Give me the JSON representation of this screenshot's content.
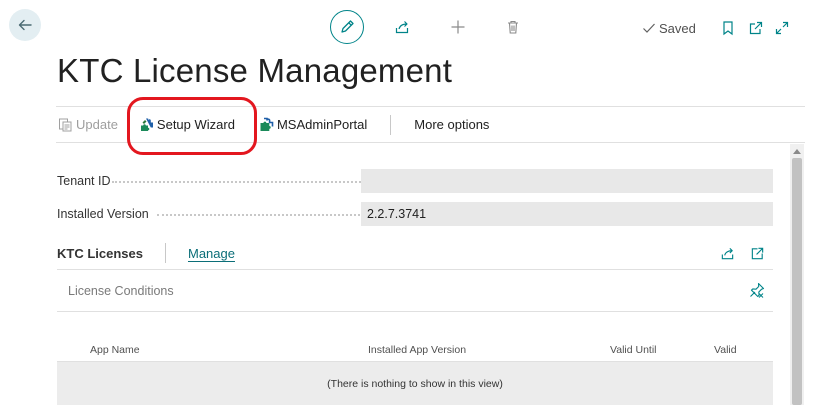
{
  "page": {
    "title": "KTC License Management",
    "status": "Saved"
  },
  "actions": {
    "update": "Update",
    "setup_wizard": "Setup Wizard",
    "ms_admin_portal": "MSAdminPortal",
    "more_options": "More options"
  },
  "fields": {
    "tenant_id": {
      "label": "Tenant ID",
      "value": ""
    },
    "installed_version": {
      "label": "Installed Version",
      "value": "2.2.7.3741"
    }
  },
  "subpage": {
    "title": "KTC Licenses",
    "manage": "Manage",
    "part_title": "License Conditions",
    "columns": [
      "App Name",
      "Installed App Version",
      "Valid Until",
      "Valid"
    ],
    "empty_text": "(There is nothing to show in this view)"
  },
  "colors": {
    "accent": "#008489",
    "highlight": "#e3171f"
  },
  "icons": [
    "back-arrow-icon",
    "pencil-icon",
    "share-icon",
    "plus-icon",
    "trash-icon",
    "check-icon",
    "bookmark-icon",
    "open-new-window-icon",
    "expand-icon",
    "update-icon",
    "puzzle-icon",
    "pin-icon"
  ]
}
